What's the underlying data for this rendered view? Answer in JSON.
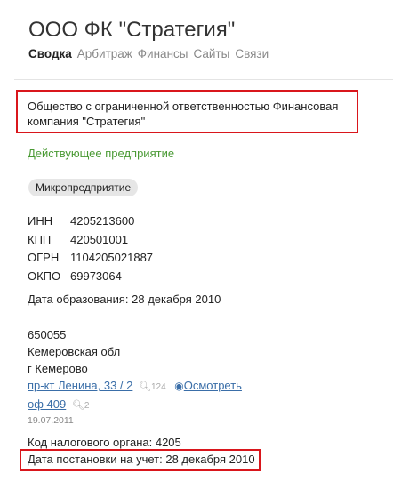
{
  "company": {
    "title": "ООО ФК \"Стратегия\"",
    "full_name": "Общество с ограниченной ответственностью Финансовая компания \"Стратегия\"",
    "status": "Действующее предприятие",
    "badge": "Микропредприятие"
  },
  "tabs": [
    {
      "label": "Сводка",
      "active": true
    },
    {
      "label": "Арбитраж",
      "active": false
    },
    {
      "label": "Финансы",
      "active": false
    },
    {
      "label": "Сайты",
      "active": false
    },
    {
      "label": "Связи",
      "active": false
    }
  ],
  "codes": [
    {
      "label": "ИНН",
      "value": "4205213600"
    },
    {
      "label": "КПП",
      "value": "420501001"
    },
    {
      "label": "ОГРН",
      "value": "1104205021887"
    },
    {
      "label": "ОКПО",
      "value": "69973064"
    }
  ],
  "founded": "Дата образования: 28 декабря 2010",
  "address": {
    "zip": "650055",
    "region": "Кемеровская обл",
    "city": "г Кемерово",
    "street": "пр-кт Ленина, 33 / 2",
    "street_count": "124",
    "view_label": "Осмотреть",
    "office": "оф 409",
    "office_count": "2",
    "date": "19.07.2011"
  },
  "tax_authority": "Код налогового органа: 4205",
  "registration": "Дата постановки на учет: 28 декабря 2010",
  "colors": {
    "highlight": "#d9161c",
    "link": "#3a6ea8",
    "status": "#4a9a34"
  }
}
